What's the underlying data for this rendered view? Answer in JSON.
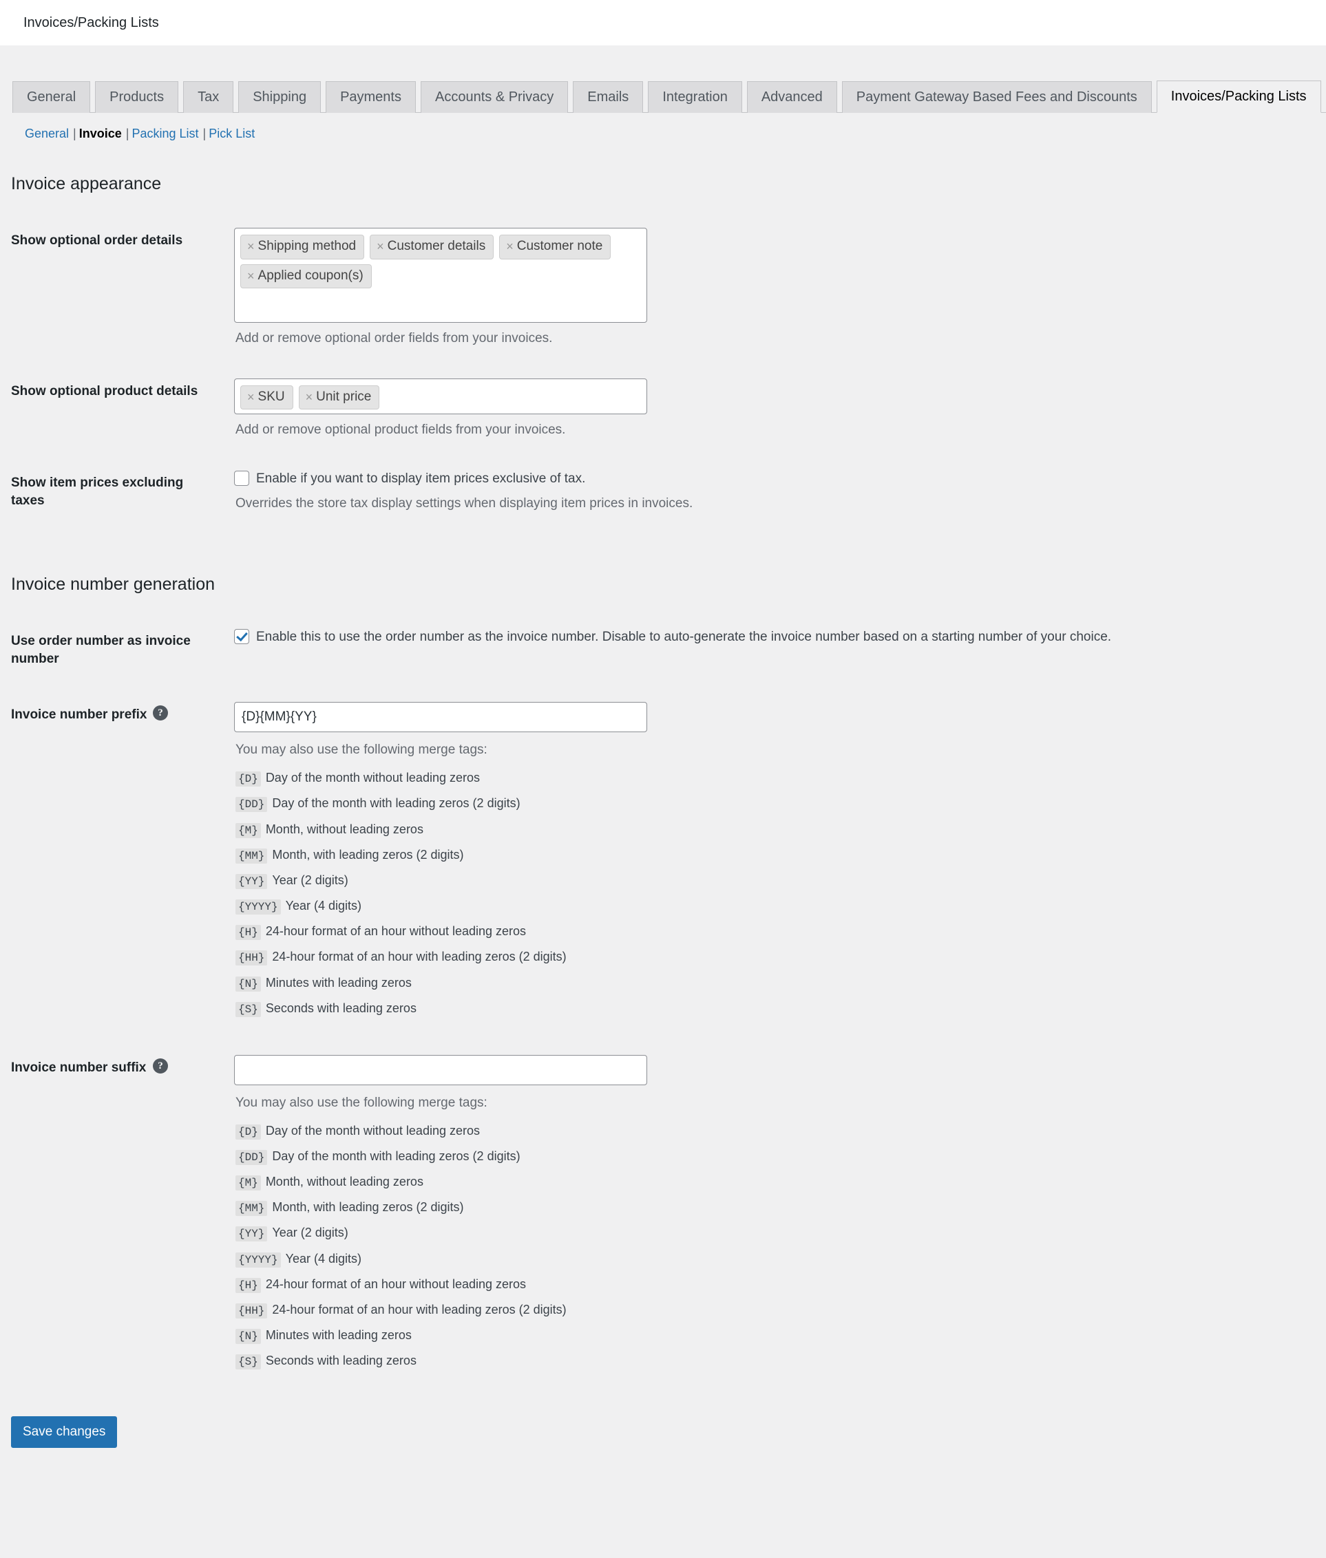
{
  "header": {
    "page_title": "Invoices/Packing Lists"
  },
  "tabs": [
    {
      "label": "General",
      "active": false
    },
    {
      "label": "Products",
      "active": false
    },
    {
      "label": "Tax",
      "active": false
    },
    {
      "label": "Shipping",
      "active": false
    },
    {
      "label": "Payments",
      "active": false
    },
    {
      "label": "Accounts & Privacy",
      "active": false
    },
    {
      "label": "Emails",
      "active": false
    },
    {
      "label": "Integration",
      "active": false
    },
    {
      "label": "Advanced",
      "active": false
    },
    {
      "label": "Payment Gateway Based Fees and Discounts",
      "active": false
    },
    {
      "label": "Invoices/Packing Lists",
      "active": true
    }
  ],
  "subnav": [
    {
      "label": "General",
      "current": false
    },
    {
      "label": "Invoice",
      "current": true
    },
    {
      "label": "Packing List",
      "current": false
    },
    {
      "label": "Pick List",
      "current": false
    }
  ],
  "sections": {
    "appearance": {
      "title": "Invoice appearance",
      "order_details": {
        "label": "Show optional order details",
        "tags": [
          "Shipping method",
          "Customer details",
          "Customer note",
          "Applied coupon(s)"
        ],
        "remove_glyph": "×",
        "description": "Add or remove optional order fields from your invoices."
      },
      "product_details": {
        "label": "Show optional product details",
        "tags": [
          "SKU",
          "Unit price"
        ],
        "remove_glyph": "×",
        "description": "Add or remove optional product fields from your invoices."
      },
      "prices_excl_tax": {
        "label": "Show item prices excluding taxes",
        "checkbox_label": "Enable if you want to display item prices exclusive of tax.",
        "checked": false,
        "description": "Overrides the store tax display settings when displaying item prices in invoices."
      }
    },
    "numbering": {
      "title": "Invoice number generation",
      "use_order_number": {
        "label": "Use order number as invoice number",
        "checkbox_label": "Enable this to use the order number as the invoice number. Disable to auto-generate the invoice number based on a starting number of your choice.",
        "checked": true
      },
      "prefix": {
        "label": "Invoice number prefix",
        "help_glyph": "?",
        "value": "{D}{MM}{YY}",
        "placeholder": "",
        "merge_intro": "You may also use the following merge tags:"
      },
      "suffix": {
        "label": "Invoice number suffix",
        "help_glyph": "?",
        "value": "",
        "placeholder": "",
        "merge_intro": "You may also use the following merge tags:"
      },
      "merge_tags": [
        {
          "tag": "{D}",
          "desc": "Day of the month without leading zeros"
        },
        {
          "tag": "{DD}",
          "desc": "Day of the month with leading zeros (2 digits)"
        },
        {
          "tag": "{M}",
          "desc": "Month, without leading zeros"
        },
        {
          "tag": "{MM}",
          "desc": "Month, with leading zeros (2 digits)"
        },
        {
          "tag": "{YY}",
          "desc": "Year (2 digits)"
        },
        {
          "tag": "{YYYY}",
          "desc": "Year (4 digits)"
        },
        {
          "tag": "{H}",
          "desc": "24-hour format of an hour without leading zeros"
        },
        {
          "tag": "{HH}",
          "desc": "24-hour format of an hour with leading zeros (2 digits)"
        },
        {
          "tag": "{N}",
          "desc": "Minutes with leading zeros"
        },
        {
          "tag": "{S}",
          "desc": "Seconds with leading zeros"
        }
      ]
    }
  },
  "footer": {
    "save_label": "Save changes"
  },
  "colors": {
    "accent": "#2271b1",
    "page_bg": "#f0f0f1",
    "tab_bg": "#dcdcde",
    "border": "#c3c4c7"
  }
}
